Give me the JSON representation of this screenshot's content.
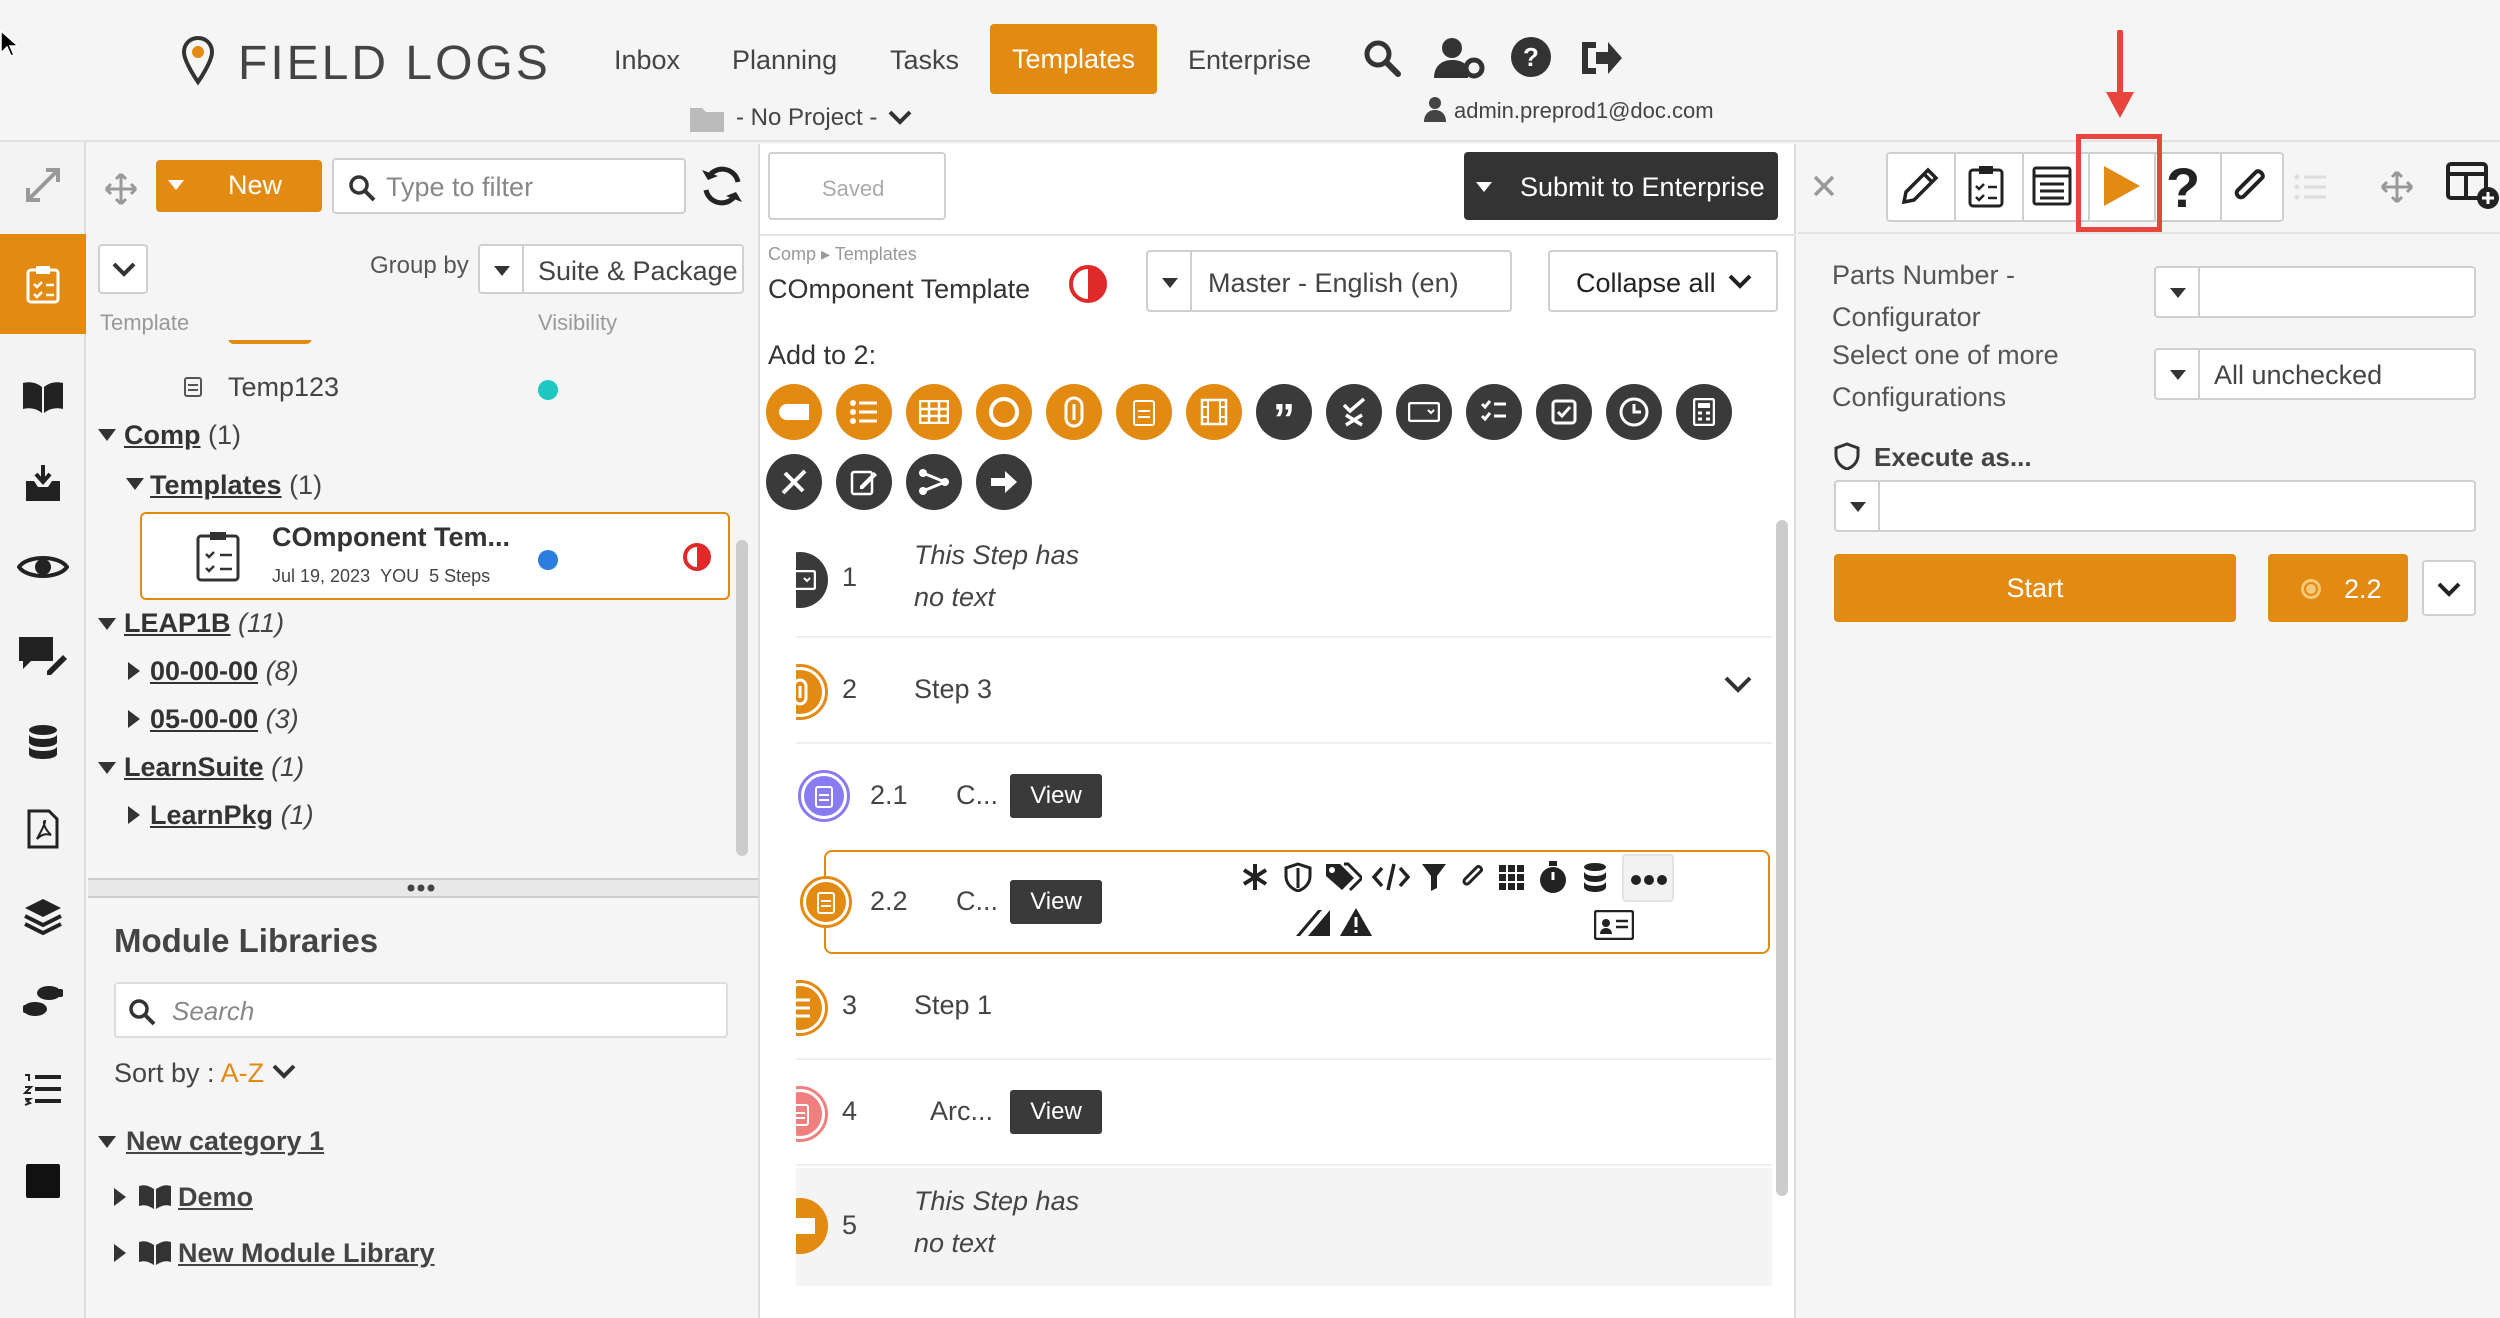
{
  "app": {
    "name": "FIELD LOGS",
    "project": "- No Project -",
    "user": "admin.preprod1@doc.com"
  },
  "nav": {
    "items": [
      "Inbox",
      "Planning",
      "Tasks",
      "Templates",
      "Enterprise"
    ],
    "active": "Templates"
  },
  "left": {
    "new_label": "New",
    "filter_placeholder": "Type to filter",
    "group_by_label": "Group by",
    "group_by_value": "Suite & Package",
    "col_template": "Template",
    "col_visibility": "Visibility",
    "tree": {
      "temp123": "Temp123",
      "comp": "Comp",
      "comp_count": "(1)",
      "templates": "Templates",
      "templates_count": "(1)",
      "selected": {
        "name": "COmponent Tem...",
        "date": "Jul 19, 2023",
        "owner": "YOU",
        "steps": "5 Steps"
      },
      "leap": "LEAP1B",
      "leap_count": "(11)",
      "leap_children": [
        {
          "name": "00-00-00",
          "count": "(8)"
        },
        {
          "name": "05-00-00",
          "count": "(3)"
        }
      ],
      "learnsuite": "LearnSuite",
      "learnsuite_count": "(1)",
      "learnpkg": "LearnPkg",
      "learnpkg_count": "(1)"
    },
    "modules": {
      "title": "Module Libraries",
      "search_placeholder": "Search",
      "sort_label": "Sort by :",
      "sort_value": "A-Z",
      "category": "New category 1",
      "libs": [
        "Demo",
        "New Module Library"
      ]
    }
  },
  "center": {
    "saved_label": "Saved",
    "submit_label": "Submit to Enterprise",
    "crumb_a": "Comp",
    "crumb_b": "Templates",
    "title": "COmponent Template",
    "lang": "Master - English (en)",
    "collapse": "Collapse all",
    "add_to": "Add to 2:",
    "steps": [
      {
        "num": "1",
        "text_a": "This Step has",
        "text_b": "no text"
      },
      {
        "num": "2",
        "text": "Step 3"
      },
      {
        "num": "2.1",
        "text": "C...",
        "view": "View"
      },
      {
        "num": "2.2",
        "text": "C...",
        "view": "View"
      },
      {
        "num": "3",
        "text": "Step 1"
      },
      {
        "num": "4",
        "text": "Arc...",
        "view": "View"
      },
      {
        "num": "5",
        "text_a": "This Step has",
        "text_b": "no text"
      }
    ]
  },
  "right": {
    "parts_label_a": "Parts Number -",
    "parts_label_b": "Configurator",
    "select_label_a": "Select one of more",
    "select_label_b": "Configurations",
    "select_value": "All unchecked",
    "execute_label": "Execute as...",
    "start_label": "Start",
    "version": "2.2"
  },
  "colors": {
    "accent": "#e38a13",
    "dark": "#3a3a3a",
    "highlight": "#e8453c",
    "teal": "#1ec8c0",
    "blue": "#2b7de0"
  }
}
